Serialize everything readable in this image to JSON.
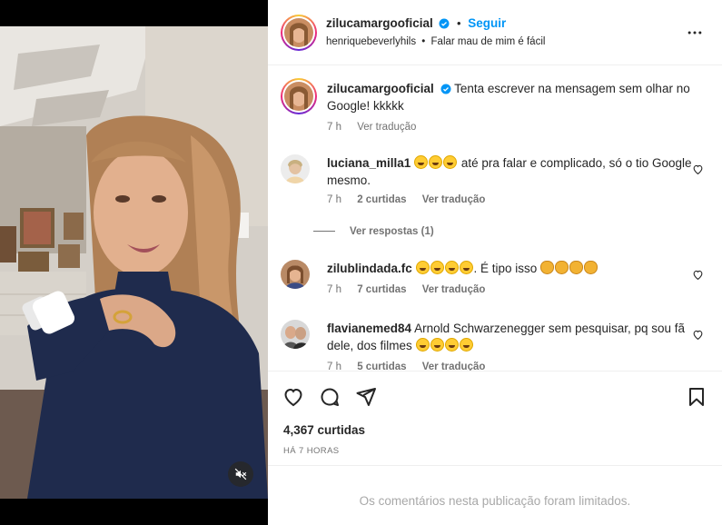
{
  "header": {
    "username": "zilucamargooficial",
    "separator": "•",
    "follow_label": "Seguir",
    "audio_owner": "henriquebeverlyhils",
    "audio_separator": "•",
    "audio_title": "Falar mau de mim é fácil",
    "more_icon": "more-horizontal-icon"
  },
  "caption": {
    "username": "zilucamargooficial",
    "text": "Tenta escrever na mensagem sem olhar no Google! kkkkk",
    "time": "7 h",
    "translate": "Ver tradução"
  },
  "comments": [
    {
      "username": "luciana_milla1",
      "text": "até pra falar e complicado, só o tio Google mesmo.",
      "emoji_count": 3,
      "time": "7 h",
      "likes": "2 curtidas",
      "translate": "Ver tradução",
      "replies": "Ver respostas (1)"
    },
    {
      "username": "zilublindada.fc",
      "text": ". É tipo isso",
      "emoji_count": 4,
      "clap_count": 4,
      "time": "7 h",
      "likes": "7 curtidas",
      "translate": "Ver tradução"
    },
    {
      "username": "flavianemed84",
      "text": "Arnold Schwarzenegger sem pesquisar, pq sou fã dele, dos filmes",
      "emoji_count": 4,
      "time": "7 h",
      "likes": "5 curtidas",
      "translate": "Ver tradução"
    }
  ],
  "actions": {
    "like_icon": "heart-icon",
    "comment_icon": "comment-icon",
    "share_icon": "send-icon",
    "save_icon": "bookmark-icon"
  },
  "stats": {
    "likes": "4,367 curtidas",
    "time": "HÁ 7 HORAS"
  },
  "footer": {
    "limited": "Os comentários nesta publicação foram limitados."
  },
  "video": {
    "mute_icon": "muted-speaker-icon"
  },
  "colors": {
    "accent": "#0095f6",
    "verified": "#0095f6",
    "muted_text": "#737373"
  }
}
